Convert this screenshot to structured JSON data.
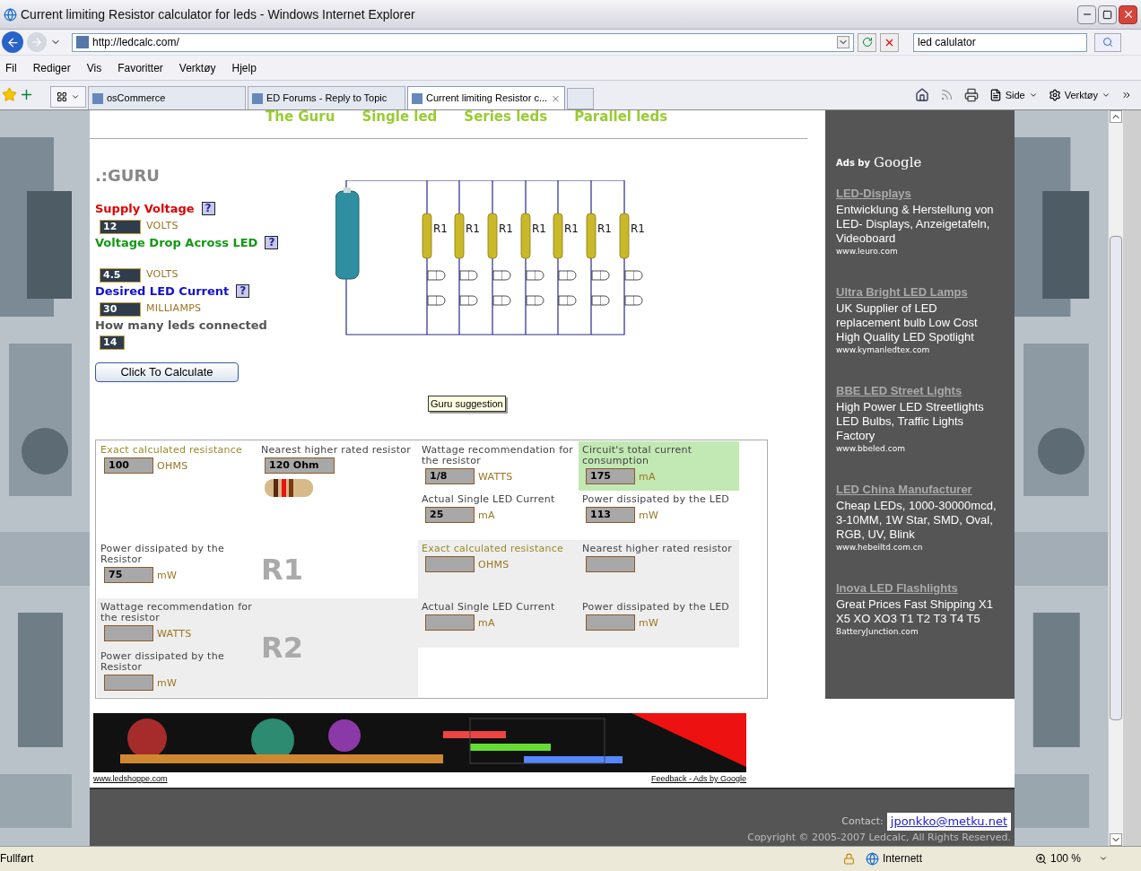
{
  "window": {
    "title": "Current limiting Resistor calculator for leds - Windows Internet Explorer"
  },
  "address": {
    "url": "http://ledcalc.com/",
    "search": "led calulator"
  },
  "menu": [
    "Fil",
    "Rediger",
    "Vis",
    "Favoritter",
    "Verktøy",
    "Hjelp"
  ],
  "tabs": [
    {
      "label": "osCommerce",
      "selected": false
    },
    {
      "label": "ED Forums - Reply to Topic",
      "selected": false
    },
    {
      "label": "Current limiting Resistor c...",
      "selected": true
    }
  ],
  "toolbar": [
    "Side",
    "Verktøy"
  ],
  "nav": [
    "The Guru",
    "Single led",
    "Series leds",
    "Parallel leds"
  ],
  "guru": {
    "heading": ".:GURU",
    "inputs": [
      {
        "label": "Supply Voltage",
        "color": "#dd0000",
        "value": "12",
        "unit": "VOLTS",
        "help": "?"
      },
      {
        "label": "Voltage Drop Across LED",
        "color": "#119911",
        "value": "4.5",
        "unit": "VOLTS",
        "help": "?"
      },
      {
        "label": "Desired LED Current",
        "color": "#1111cc",
        "value": "30",
        "unit": "MILLIAMPS",
        "help": "?"
      },
      {
        "label": "How many leds connected",
        "color": "#555555",
        "value": "14"
      }
    ],
    "button": "Click To Calculate",
    "tooltip": "Guru suggestion"
  },
  "circuit": {
    "labels": [
      "R1",
      "R1",
      "R1",
      "R1",
      "R1",
      "R1",
      "R1"
    ]
  },
  "results": {
    "fields": [
      {
        "label": "Exact calculated resistance",
        "color": "#9a8a2a",
        "value": "100",
        "unit": "OHMS",
        "kind": "field",
        "shaded": false,
        "highlighted": false
      },
      {
        "label": "Nearest higher rated resistor",
        "color": "#444444",
        "value": "120 Ohm",
        "kind": "resistor",
        "shaded": false,
        "highlighted": false
      },
      {
        "label": "Wattage recommendation for the resistor",
        "color": "#444444",
        "value": "1/8",
        "unit": "WATTS",
        "kind": "field",
        "shaded": false,
        "highlighted": false
      },
      {
        "label": "Circuit's total current consumption",
        "color": "#444444",
        "value": "175",
        "unit": "mA",
        "kind": "field",
        "shaded": false,
        "highlighted": true
      },
      {
        "label": "Actual Single LED Current",
        "color": "#444444",
        "value": "25",
        "unit": "mA",
        "kind": "field",
        "shaded": false,
        "highlighted": false
      },
      {
        "label": "Power dissipated by the LED",
        "color": "#444444",
        "value": "113",
        "unit": "mW",
        "kind": "field",
        "shaded": false,
        "highlighted": false
      },
      {
        "label": "Power dissipated by the Resistor",
        "color": "#444444",
        "value": "75",
        "unit": "mW",
        "kind": "field",
        "shaded": false,
        "highlighted": false
      },
      {
        "label": "Exact calculated resistance",
        "color": "#9a8a2a",
        "unit": "OHMS",
        "kind": "field",
        "shaded": true,
        "highlighted": false
      },
      {
        "label": "Nearest higher rated resistor",
        "color": "#444444",
        "kind": "field",
        "shaded": true,
        "highlighted": false
      },
      {
        "label": "Wattage recommendation for the resistor",
        "color": "#444444",
        "unit": "WATTS",
        "kind": "field",
        "shaded": true,
        "highlighted": false
      },
      {
        "label": "Actual Single LED Current",
        "color": "#444444",
        "unit": "mA",
        "kind": "field",
        "shaded": true,
        "highlighted": false
      },
      {
        "label": "Power dissipated by the LED",
        "color": "#444444",
        "unit": "mW",
        "kind": "field",
        "shaded": true,
        "highlighted": false
      },
      {
        "label": "Power dissipated by the Resistor",
        "color": "#444444",
        "unit": "mW",
        "kind": "field",
        "shaded": true,
        "highlighted": false
      }
    ],
    "markers": [
      {
        "label": "R1",
        "shaded": false
      },
      {
        "label": "R2",
        "shaded": true
      }
    ]
  },
  "ads": {
    "prefix": "Ads by",
    "brand": "Google",
    "items": [
      {
        "title": "LED-Displays",
        "body": "Entwicklung & Herstellung von LED- Displays, Anzeigetafeln, Videoboard",
        "url": "www.leuro.com"
      },
      {
        "title": "Ultra Bright LED Lamps",
        "body": "UK Supplier of LED replacement bulb Low Cost High Quality LED Spotlight",
        "url": "www.kymanledtex.com"
      },
      {
        "title": "BBE LED Street Lights",
        "body": "High Power LED Streetlights LED Bulbs, Traffic Lights Factory",
        "url": "www.bbeled.com"
      },
      {
        "title": "LED China Manufacturer",
        "body": "Cheap LEDs, 1000-30000mcd, 3-10MM, 1W Star, SMD, Oval, RGB, UV, Blink",
        "url": "www.hebeiltd.com.cn"
      },
      {
        "title": "Inova LED Flashlights",
        "body": "Great Prices Fast Shipping X1 X5 XO XO3 T1 T2 T3 T4 T5",
        "url": "BatteryJunction.com"
      }
    ]
  },
  "banner": {
    "left_link": "www.ledshoppe.com",
    "right_link": "Feedback - Ads by Google"
  },
  "footer": {
    "contact_label": "Contact:",
    "email": "jponkko@metku.net",
    "copyright": "Copyright © 2005-2007 Ledcalc, All Rights Reserved."
  },
  "status": {
    "text": "Fullført",
    "zone": "Internett",
    "zoom": "100 %"
  }
}
